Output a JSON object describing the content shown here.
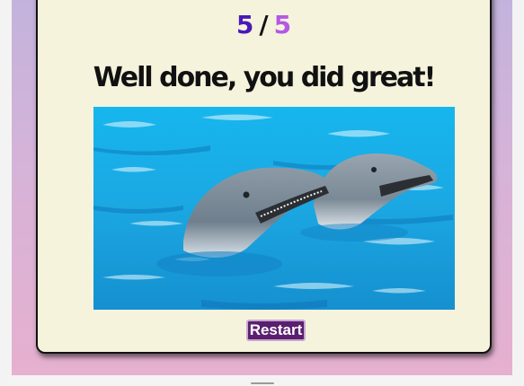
{
  "result": {
    "score_correct": "5",
    "score_separator": "/",
    "score_total": "5",
    "message": "Well done, you did great!"
  },
  "image": {
    "subject": "two dolphins in blue water"
  },
  "actions": {
    "restart_label": "Restart"
  },
  "colors": {
    "score_correct": "#4a19b8",
    "score_total": "#b457e6",
    "card_background": "#f5f3dc",
    "button_background": "#5a1f6e",
    "page_gradient_top": "#c3b3dc",
    "page_gradient_bottom": "#e6b0cf"
  }
}
